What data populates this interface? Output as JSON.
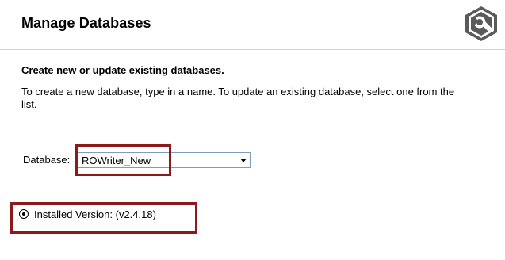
{
  "header": {
    "title": "Manage Databases",
    "logo_icon": "wrench-settings-icon"
  },
  "main": {
    "subheading": "Create new or update existing databases.",
    "description": "To create a new database, type in a name. To update an existing database, select one from the list.",
    "database": {
      "label": "Database:",
      "value": "ROWriter_New"
    },
    "installed_version": {
      "label": "Installed Version: (v2.4.18)",
      "selected": true
    }
  },
  "colors": {
    "highlight": "#8b1a1a",
    "logo_gray": "#5a5a5a"
  }
}
